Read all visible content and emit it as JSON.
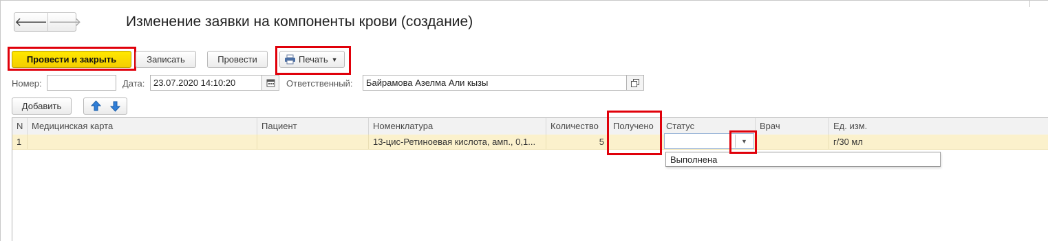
{
  "nav": {
    "back_icon": "arrow-left-icon",
    "forward_icon": "arrow-right-icon"
  },
  "page_title": "Изменение заявки на компоненты крови (создание)",
  "toolbar": {
    "post_and_close": "Провести и закрыть",
    "save": "Записать",
    "post": "Провести",
    "print": "Печать",
    "print_icon": "printer-icon"
  },
  "header_fields": {
    "number_label": "Номер:",
    "number_value": "",
    "date_label": "Дата:",
    "date_value": "23.07.2020 14:10:20",
    "responsible_label": "Ответственный:",
    "responsible_value": "Байрамова Азелма Али кызы"
  },
  "table_toolbar": {
    "add": "Добавить",
    "move_up_icon": "arrow-up-icon",
    "move_down_icon": "arrow-down-icon"
  },
  "table": {
    "columns": [
      "N",
      "Медицинская карта",
      "Пациент",
      "Номенклатура",
      "Количество",
      "Получено",
      "Статус",
      "Врач",
      "Ед. изм."
    ],
    "rows": [
      {
        "n": "1",
        "medical_card": "",
        "patient": "",
        "nomenclature": "13-цис-Ретиноевая кислота, амп., 0,1...",
        "quantity": "5",
        "received": "",
        "status": "",
        "doctor": "",
        "unit": "г/30 мл"
      }
    ]
  },
  "status_dropdown": {
    "options": [
      "Выполнена"
    ]
  },
  "colors": {
    "highlight": "#e0000a",
    "primary_button": "#f9d900",
    "selected_row": "#fbf1cc"
  }
}
